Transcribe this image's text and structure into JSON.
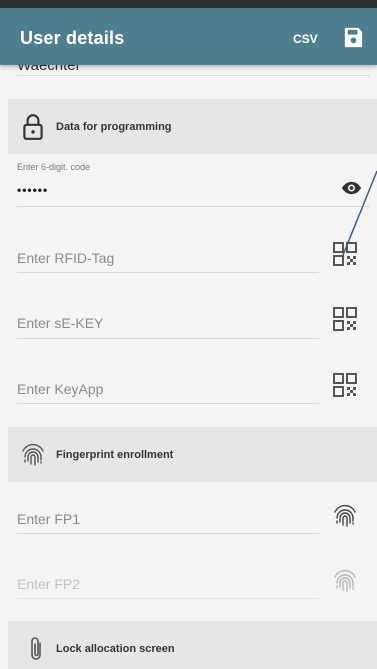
{
  "app_bar": {
    "title": "User details",
    "csv_label": "CSV",
    "save_icon": "save-icon"
  },
  "partial_field_text": "Waechter",
  "sections": {
    "programming": {
      "label": "Data for programming",
      "icon": "lock-icon"
    },
    "fingerprint": {
      "label": "Fingerprint enrollment",
      "icon": "fingerprint-icon"
    },
    "lock_allocation": {
      "label": "Lock allocation screen",
      "icon": "paperclip-icon"
    }
  },
  "code_field": {
    "label": "Enter 6-digit. code",
    "value": "••••••",
    "icon": "eye-icon"
  },
  "rfid_field": {
    "placeholder": "Enter RFID-Tag",
    "icon": "qr-code-icon"
  },
  "sekey_field": {
    "placeholder": "Enter sE-KEY",
    "icon": "qr-code-icon"
  },
  "keyapp_field": {
    "placeholder": "Enter KeyApp",
    "icon": "qr-code-icon"
  },
  "fp1_field": {
    "placeholder": "Enter FP1",
    "icon": "fingerprint-icon"
  },
  "fp2_field": {
    "placeholder": "Enter FP2",
    "icon": "fingerprint-icon"
  },
  "colors": {
    "app_bar": "#4f7f8f",
    "section_bg": "#e6e6e6",
    "page_bg": "#f4f4f4",
    "annotation_line": "#3a5a8a"
  }
}
